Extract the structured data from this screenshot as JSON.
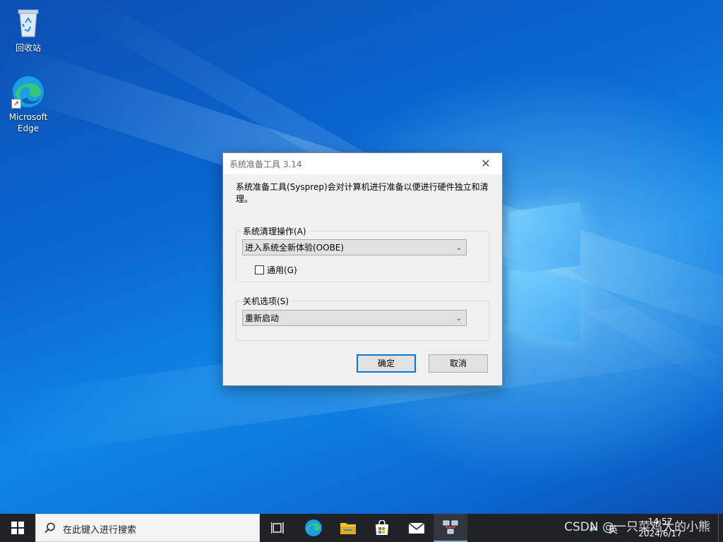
{
  "desktop": {
    "icons": [
      {
        "label": "回收站",
        "icon": "recycle-bin-icon"
      },
      {
        "label": "Microsoft\nEdge",
        "icon": "edge-icon"
      }
    ]
  },
  "dialog": {
    "title": "系统准备工具 3.14",
    "description": "系统准备工具(Sysprep)会对计算机进行准备以便进行硬件独立和清理。",
    "cleanup_group_label": "系统清理操作(A)",
    "cleanup_selected": "进入系统全新体验(OOBE)",
    "generalize_label": "通用(G)",
    "generalize_checked": false,
    "shutdown_group_label": "关机选项(S)",
    "shutdown_selected": "重新启动",
    "ok_label": "确定",
    "cancel_label": "取消"
  },
  "taskbar": {
    "search_placeholder": "在此键入进行搜索",
    "pinned": [
      "task-view-icon",
      "edge-icon",
      "file-explorer-icon",
      "store-icon",
      "mail-icon",
      "network-icon"
    ],
    "tray": {
      "ime": "英",
      "time": "14:57",
      "date": "2024/6/17"
    }
  },
  "watermark": "CSDN @一只菜鸡大的小熊",
  "colors": {
    "accent": "#0078d7",
    "taskbar_bg": "#1f2227"
  }
}
